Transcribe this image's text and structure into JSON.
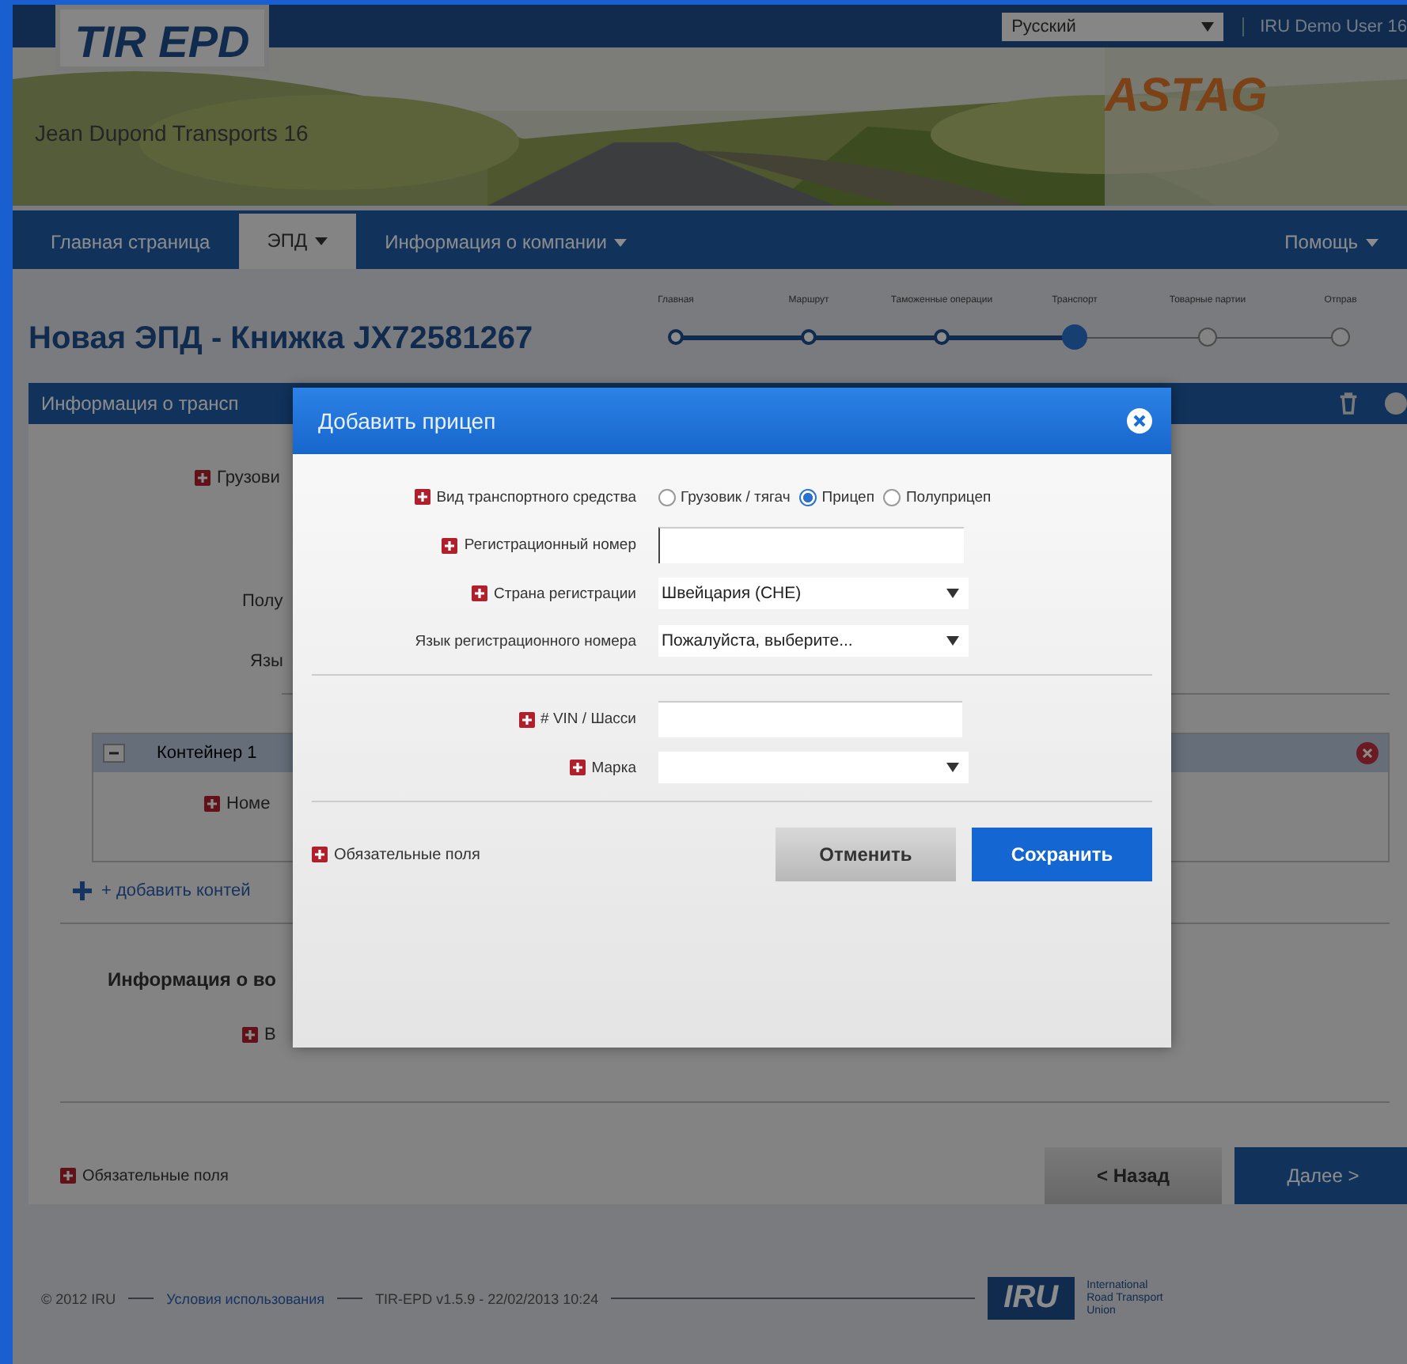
{
  "header": {
    "logo": "TIR EPD",
    "language": "Русский",
    "user": "IRU Demo User 16",
    "company": "Jean Dupond Transports 16",
    "partner_logo": "ASTAG"
  },
  "nav": [
    {
      "label": "Главная страница",
      "selected": false,
      "dropdown": false
    },
    {
      "label": "ЭПД",
      "selected": true,
      "dropdown": true
    },
    {
      "label": "Информация о компании",
      "selected": false,
      "dropdown": true
    },
    {
      "label": "Помощь",
      "selected": false,
      "dropdown": true
    }
  ],
  "page_title": "Новая ЭПД - Книжка JX72581267",
  "steps": [
    {
      "label": "Главная",
      "done": true,
      "current": false
    },
    {
      "label": "Маршрут",
      "done": true,
      "current": false
    },
    {
      "label": "Таможенные операции",
      "done": true,
      "current": false
    },
    {
      "label": "Транспорт",
      "done": false,
      "current": true
    },
    {
      "label": "Товарные партии",
      "done": false,
      "current": false
    },
    {
      "label": "Отправ",
      "done": false,
      "current": false
    }
  ],
  "section": {
    "title": "Информация о трансп",
    "rows": [
      {
        "label": "Грузови",
        "required": true
      },
      {
        "label": "Полу",
        "required": false
      },
      {
        "label": "Язы",
        "required": false
      }
    ],
    "container": {
      "title": "Контейнер 1",
      "expanded": true,
      "rows": [
        {
          "label": "Номе",
          "required": true
        }
      ]
    },
    "add_link": "+ добавить контей",
    "subheading": "Информация о во",
    "sub_rows": [
      {
        "label": "В",
        "required": true
      }
    ],
    "required_note": "Обязательные поля",
    "buttons": [
      {
        "label": "< Назад",
        "kind": "secondary"
      },
      {
        "label": "Далее >",
        "kind": "primary"
      }
    ]
  },
  "footer": {
    "copyright": "© 2012 IRU",
    "terms": "Условия использования",
    "version": "TIR-EPD v1.5.9 - 22/02/2013 10:24",
    "logo": "IRU",
    "logo_caption": "International Road Transport Union"
  },
  "dialog": {
    "title": "Добавить прицеп",
    "groups": [
      [
        {
          "kind": "radio",
          "label": "Вид транспортного средства",
          "required": true,
          "options": [
            {
              "label": "Грузовик / тягач",
              "selected": false
            },
            {
              "label": "Прицеп",
              "selected": true
            },
            {
              "label": "Полуприцеп",
              "selected": false
            }
          ]
        },
        {
          "kind": "input",
          "label": "Регистрационный номер",
          "required": true
        },
        {
          "kind": "select",
          "label": "Страна регистрации",
          "required": true,
          "value": "Швейцария (CHE)"
        },
        {
          "kind": "select",
          "label": "Язык регистрационного номера",
          "required": false,
          "value": "Пожалуйста, выберите..."
        }
      ],
      [
        {
          "kind": "input",
          "label": "# VIN / Шасси",
          "required": true
        },
        {
          "kind": "select",
          "label": "Марка",
          "required": true
        }
      ]
    ],
    "required_note": "Обязательные поля",
    "buttons": [
      {
        "label": "Отменить",
        "kind": "secondary"
      },
      {
        "label": "Сохранить",
        "kind": "primary"
      }
    ]
  }
}
